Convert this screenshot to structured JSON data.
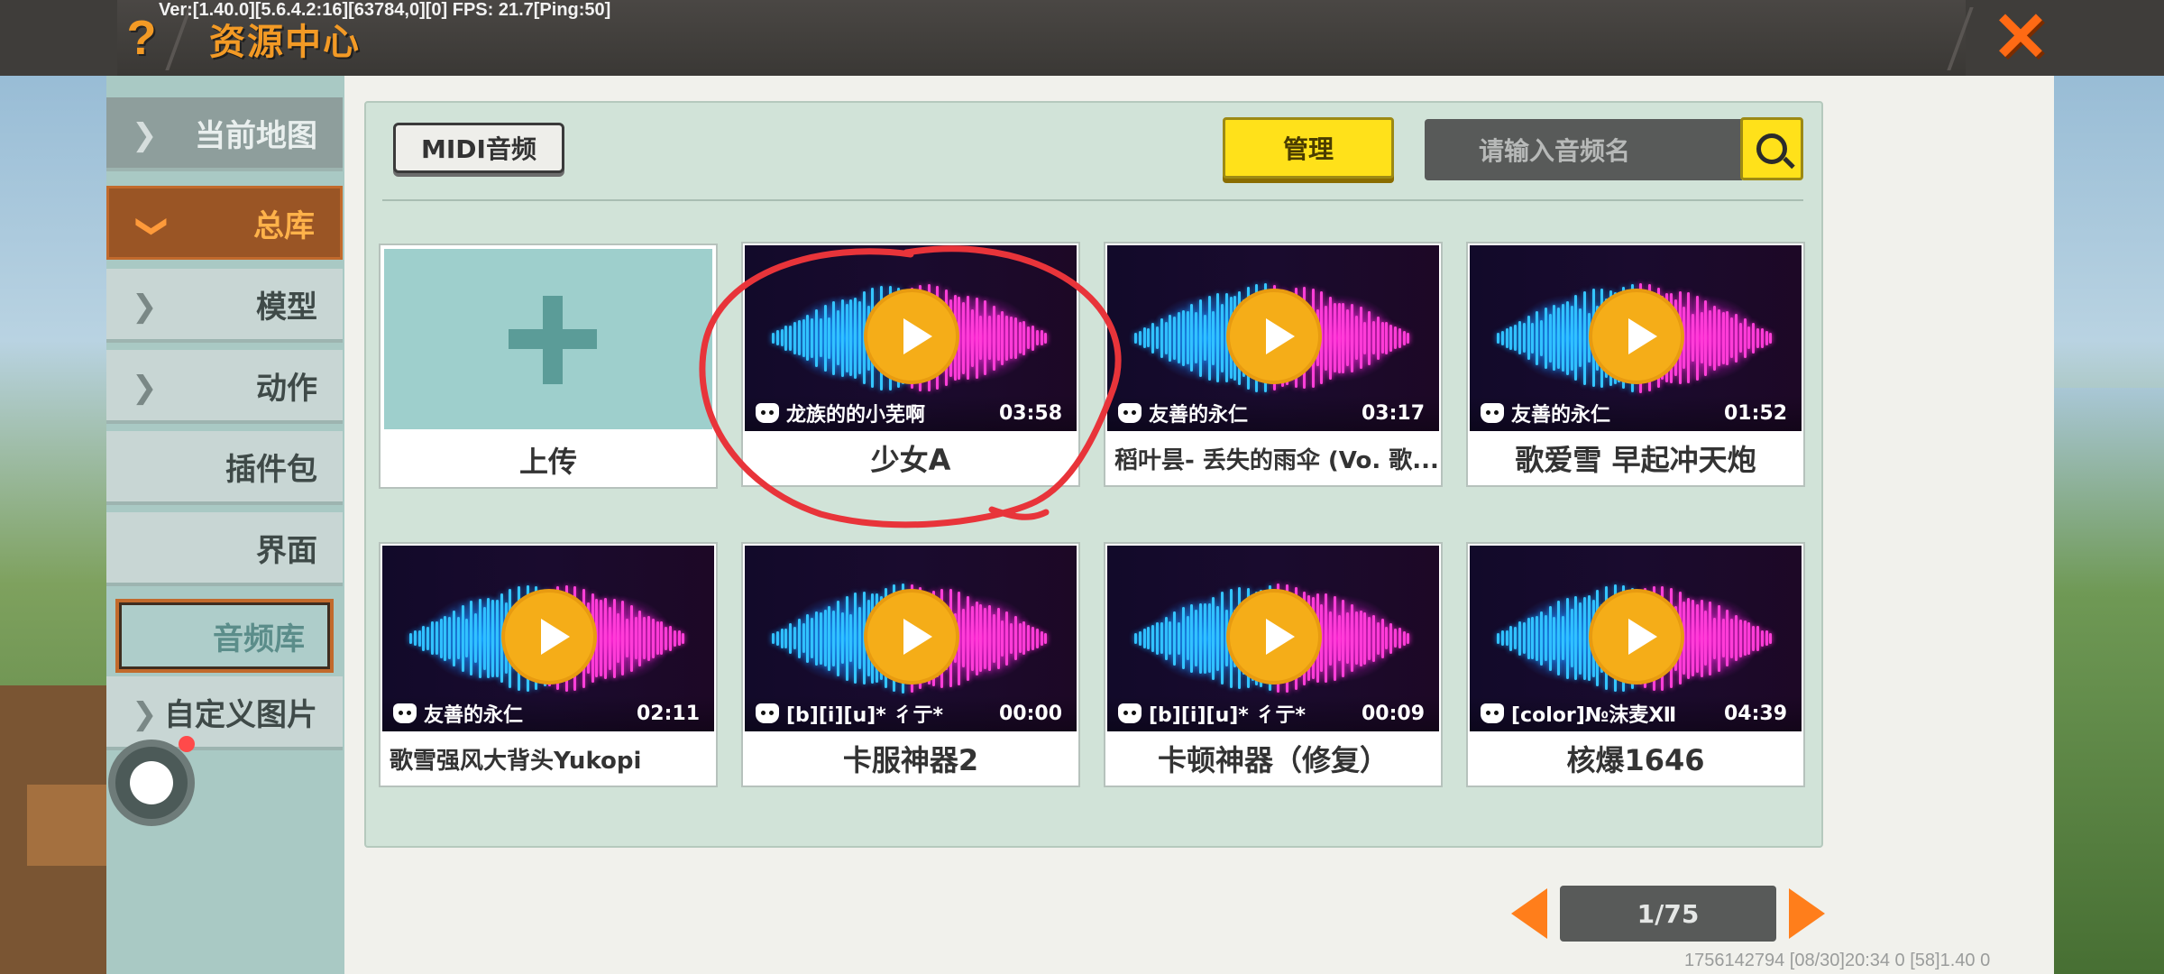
{
  "debug_text": "Ver:[1.40.0][5.6.4.2:16][63784,0][0] FPS: 21.7[Ping:50]",
  "header": {
    "help_icon": "?",
    "title": "资源中心",
    "close_icon": "✕"
  },
  "sidebar": {
    "items": [
      {
        "label": "当前地图",
        "has_chevron": true
      },
      {
        "label": "总库",
        "has_chevron": true
      },
      {
        "label": "模型",
        "has_chevron": true
      },
      {
        "label": "动作",
        "has_chevron": true
      },
      {
        "label": "插件包",
        "has_chevron": false
      },
      {
        "label": "界面",
        "has_chevron": false
      },
      {
        "label": "音频库",
        "has_chevron": false
      },
      {
        "label": "自定义图片",
        "has_chevron": true
      }
    ]
  },
  "toolbar": {
    "midi_label": "MIDI音频",
    "manage_label": "管理",
    "search_placeholder": "请输入音频名"
  },
  "upload": {
    "label": "上传"
  },
  "cards": [
    {
      "author": "龙族的的小芜啊",
      "duration": "03:58",
      "title": "少女A"
    },
    {
      "author": "友善的永仁",
      "duration": "03:17",
      "title": "稻叶昙- 丢失的雨伞 (Vo. 歌..."
    },
    {
      "author": "友善的永仁",
      "duration": "01:52",
      "title": "歌爱雪  早起冲天炮"
    },
    {
      "author": "友善的永仁",
      "duration": "02:11",
      "title": "歌雪强风大背头Yukopi"
    },
    {
      "author": "[b][i][u]* 彳亍*",
      "duration": "00:00",
      "title": "卡服神器2"
    },
    {
      "author": "[b][i][u]* 彳亍*",
      "duration": "00:09",
      "title": "卡顿神器（修复）"
    },
    {
      "author": "[color]№沫麦Ⅻ",
      "duration": "04:39",
      "title": "核爆1646"
    }
  ],
  "pager": {
    "text": "1/75"
  },
  "footer_info": "1756142794    [08/30]20:34 0    [58]1.40 0",
  "colors": {
    "accent_orange": "#f39a25",
    "button_yellow": "#ffe11a",
    "panel_green": "#d1e3d8",
    "annotation_red": "#e8343a"
  }
}
